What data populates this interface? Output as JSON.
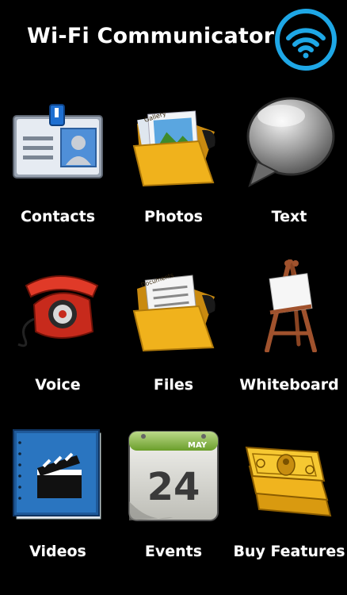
{
  "app_title": "Wi-Fi Communicator",
  "colors": {
    "wifi_accent": "#1ea7e6",
    "background": "#000000"
  },
  "header": {
    "wifi_icon": "wifi-icon"
  },
  "grid": [
    {
      "label": "Contacts",
      "icon": "contact-card-icon"
    },
    {
      "label": "Photos",
      "icon": "photo-folder-icon"
    },
    {
      "label": "Text",
      "icon": "speech-bubble-icon"
    },
    {
      "label": "Voice",
      "icon": "telephone-icon"
    },
    {
      "label": "Files",
      "icon": "document-folder-icon"
    },
    {
      "label": "Whiteboard",
      "icon": "easel-icon"
    },
    {
      "label": "Videos",
      "icon": "clapperboard-icon"
    },
    {
      "label": "Events",
      "icon": "calendar-icon"
    },
    {
      "label": "Buy Features",
      "icon": "money-icon"
    }
  ],
  "calendar": {
    "month": "MAY",
    "day": "24"
  },
  "folder_tabs": {
    "photos": "Gallery",
    "files": "Documents"
  }
}
